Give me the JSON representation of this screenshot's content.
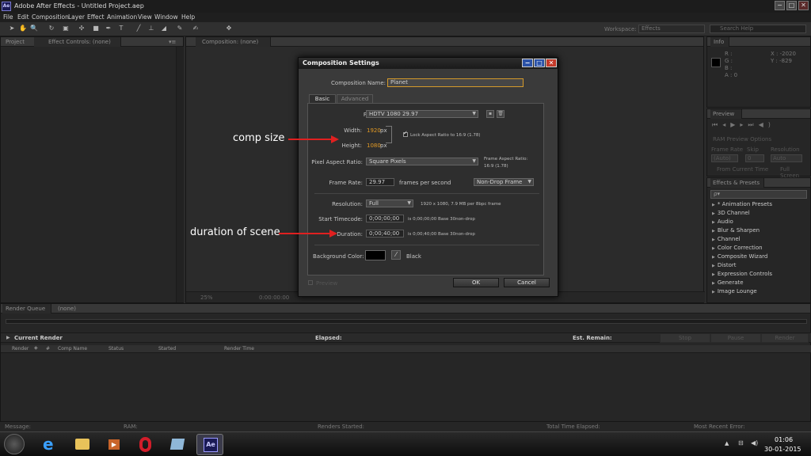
{
  "app": {
    "title": "Adobe After Effects - Untitled Project.aep",
    "logo": "Ae",
    "window_controls": [
      "−",
      "□",
      "✕"
    ]
  },
  "menu": [
    "File",
    "Edit",
    "Composition",
    "Layer",
    "Effect",
    "Animation",
    "View",
    "Window",
    "Help"
  ],
  "toolbar": {
    "workspace_label": "Workspace:",
    "workspace_value": "Effects",
    "search_placeholder": "Search Help"
  },
  "left_panel": {
    "tab_project": "Project",
    "tab_effect_controls": "Effect Controls: (none)"
  },
  "comp_panel": {
    "tab": "Composition: (none)",
    "zoom": "25%",
    "timecode": "0:00:00:00"
  },
  "info_panel": {
    "tab": "Info",
    "r": "R :",
    "g": "G :",
    "b": "B :",
    "a": "A : 0",
    "x": "X : -2020",
    "y": "Y : -829"
  },
  "preview_panel": {
    "tab": "Preview",
    "ram_options": "RAM Preview Options",
    "frame_rate_label": "Frame Rate",
    "skip_label": "Skip",
    "resolution_label": "Resolution",
    "frame_rate_value": "(Auto)",
    "skip_value": "0",
    "resolution_value": "Auto",
    "from_current": "From Current Time",
    "full_screen": "Full Screen"
  },
  "effects_panel": {
    "tab": "Effects & Presets",
    "search_placeholder": "ρ▾",
    "items": [
      "* Animation Presets",
      "3D Channel",
      "Audio",
      "Blur & Sharpen",
      "Channel",
      "Color Correction",
      "Composite Wizard",
      "Distort",
      "Expression Controls",
      "Generate",
      "Image Lounge"
    ]
  },
  "dialog": {
    "title": "Composition Settings",
    "comp_name_label": "Composition Name:",
    "comp_name_value": "Planet",
    "tab_basic": "Basic",
    "tab_advanced": "Advanced",
    "preset_label": "Preset:",
    "preset_value": "HDTV 1080 29.97",
    "width_label": "Width:",
    "width_value": "1920",
    "height_label": "Height:",
    "height_value": "1080",
    "px": "px",
    "lock_aspect": "Lock Aspect Ratio to 16:9 (1.78)",
    "par_label": "Pixel Aspect Ratio:",
    "par_value": "Square Pixels",
    "frame_aspect_label": "Frame Aspect Ratio:",
    "frame_aspect_value": "16:9 (1.78)",
    "frame_rate_label": "Frame Rate:",
    "frame_rate_value": "29.97",
    "fps": "frames per second",
    "drop_frame_value": "Non-Drop Frame",
    "resolution_label": "Resolution:",
    "resolution_value": "Full",
    "resolution_note": "1920 x 1080, 7.9 MB per 8bpc frame",
    "start_tc_label": "Start Timecode:",
    "start_tc_value": "0;00;00;00",
    "start_tc_note": "is 0;00;00;00  Base 30non-drop",
    "duration_label": "Duration:",
    "duration_value": "0;00;40;00",
    "duration_note": "is 0;00;40;00  Base 30non-drop",
    "bg_color_label": "Background Color:",
    "bg_color_name": "Black",
    "bg_color_hex": "#000000",
    "preview": "Preview",
    "ok": "OK",
    "cancel": "Cancel"
  },
  "annotations": {
    "comp_size": "comp size",
    "duration_of_scene": "duration of scene",
    "arrow_color": "#e02020"
  },
  "render_queue": {
    "tab": "Render Queue",
    "tab2": "(none)",
    "current_render": "Current Render",
    "elapsed": "Elapsed:",
    "est_remain": "Est. Remain:",
    "stop": "Stop",
    "pause": "Pause",
    "render": "Render",
    "columns": [
      "Render",
      "#",
      "Comp Name",
      "Status",
      "Started",
      "Render Time"
    ]
  },
  "status": {
    "message": "Message:",
    "ram": "RAM:",
    "renders_started": "Renders Started:",
    "total_time": "Total Time Elapsed:",
    "recent_error": "Most Recent Error:"
  },
  "taskbar": {
    "time": "01:06",
    "date": "30-01-2015"
  }
}
